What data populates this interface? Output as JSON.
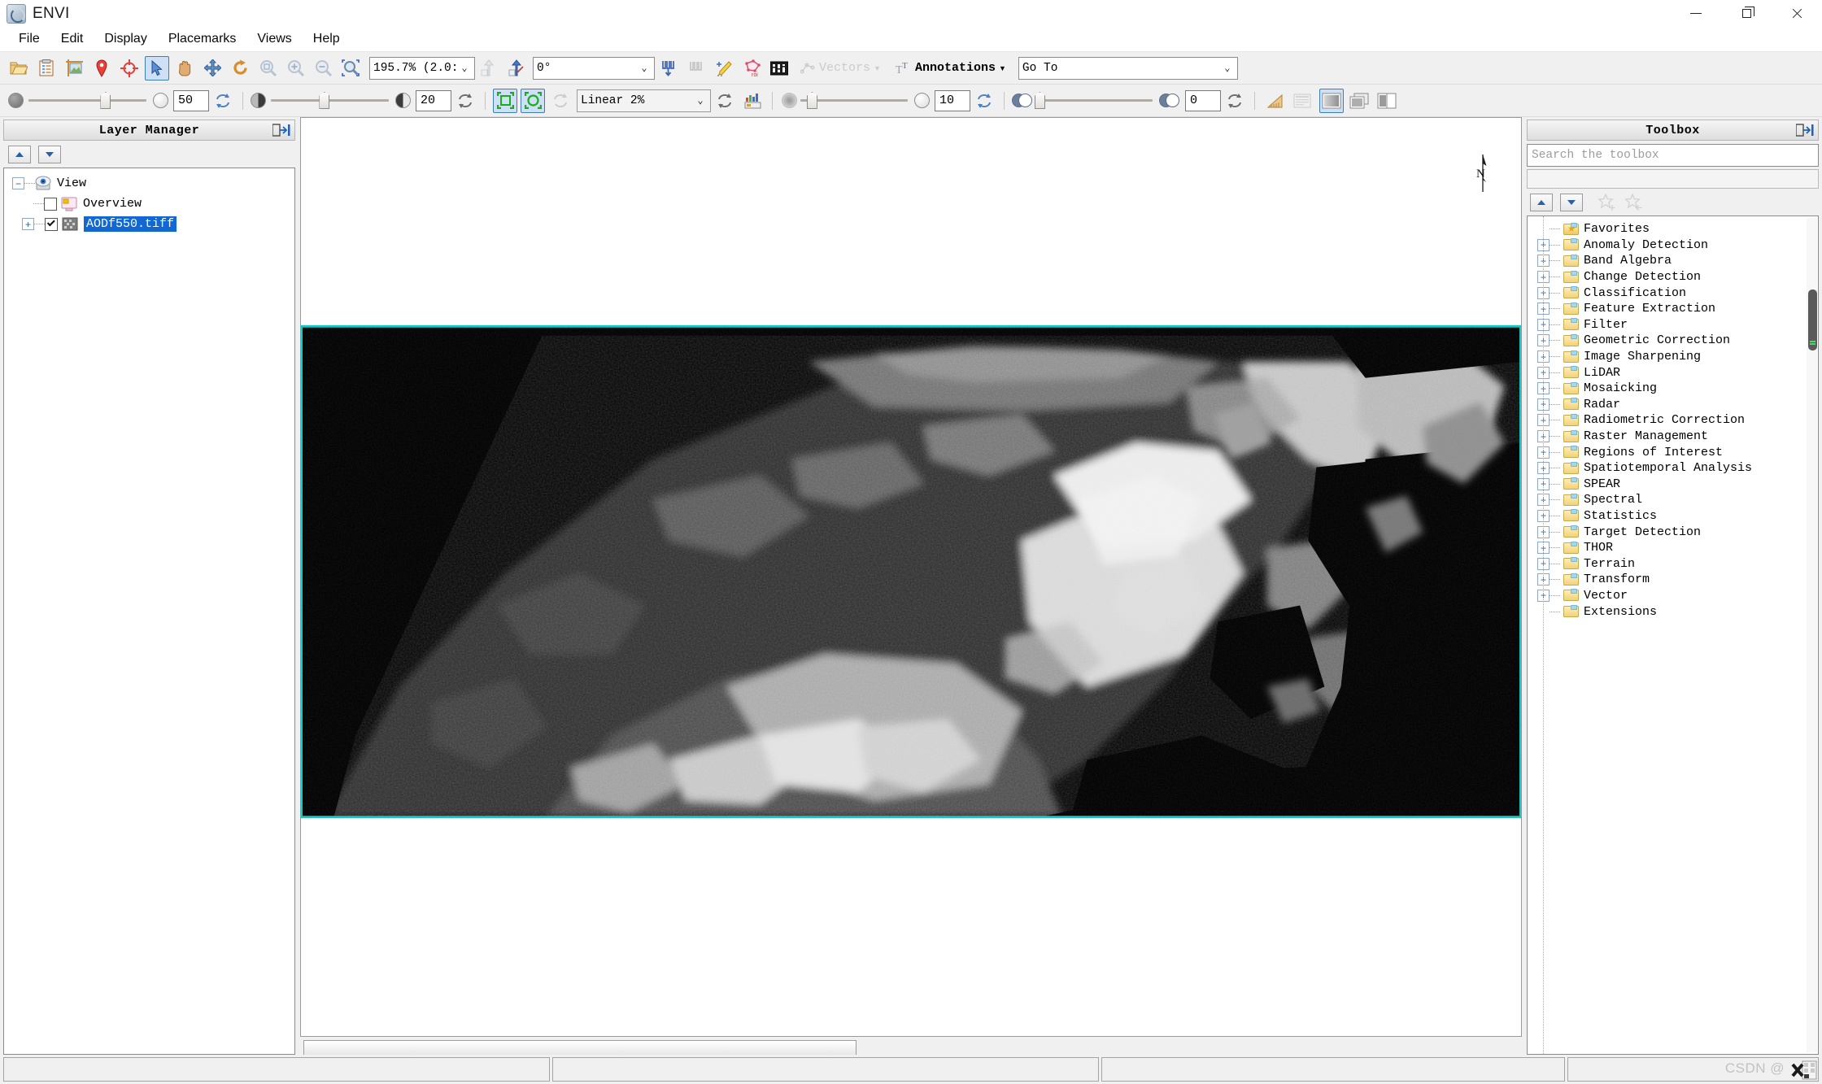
{
  "window": {
    "title": "ENVI",
    "controls": {
      "minimize": "minimize-icon",
      "maximize": "restore-icon",
      "close": "close-icon"
    }
  },
  "menubar": {
    "items": [
      {
        "label": "File"
      },
      {
        "label": "Edit"
      },
      {
        "label": "Display"
      },
      {
        "label": "Placemarks"
      },
      {
        "label": "Views"
      },
      {
        "label": "Help"
      }
    ]
  },
  "toolbar_main": {
    "buttons": [
      {
        "name": "open-file-icon",
        "tip": "Open"
      },
      {
        "name": "open-recent-icon",
        "tip": "Open Recent"
      },
      {
        "name": "crop-raster-icon",
        "tip": "Crop Raster"
      },
      {
        "name": "placemark-icon",
        "tip": "Placemark"
      },
      {
        "name": "crosshair-icon",
        "tip": "Crosshair"
      },
      {
        "name": "select-pointer-icon",
        "tip": "Select",
        "selected": true
      },
      {
        "name": "pan-hand-icon",
        "tip": "Pan"
      },
      {
        "name": "fly-icon",
        "tip": "Fly"
      },
      {
        "name": "rotate-icon",
        "tip": "Rotate"
      },
      {
        "name": "zoom-to-extent-icon",
        "tip": "Zoom to Full Extent",
        "disabled": true
      },
      {
        "name": "zoom-in-icon",
        "tip": "Zoom In",
        "disabled": true
      },
      {
        "name": "zoom-out-icon",
        "tip": "Zoom Out",
        "disabled": true
      },
      {
        "name": "zoom-to-selection-icon",
        "tip": "Zoom To Selection"
      }
    ],
    "zoom_value": "195.7% (2.0::",
    "rotation_value": "0°",
    "post_buttons": [
      {
        "name": "north-up-icon",
        "disabled": true
      },
      {
        "name": "rotate-north-icon",
        "disabled": false
      },
      {
        "name": "spectral-profile-icon"
      },
      {
        "name": "spectral-profile-alt-icon",
        "disabled": true
      },
      {
        "name": "annotation-pen-icon"
      },
      {
        "name": "region-of-interest-icon"
      },
      {
        "name": "band-math-icon"
      }
    ],
    "vectors_label": "Vectors",
    "annotations_label": "Annotations",
    "goto_value": "Go To"
  },
  "toolbar_display": {
    "transparency_value": "50",
    "brightness_value": "20",
    "stretch_value": "Linear 2%",
    "sharpen_value": "10",
    "blend_value": "0",
    "buttons": [
      {
        "name": "transparency-reset-icon"
      },
      {
        "name": "brightness-reset-icon"
      },
      {
        "name": "contrast-zoom-fit-icon",
        "selected": true
      },
      {
        "name": "contrast-zoom-region-icon",
        "selected": true
      },
      {
        "name": "stretch-refresh-icon",
        "disabled": true
      },
      {
        "name": "stretch-reset-icon"
      },
      {
        "name": "histogram-stretch-icon"
      },
      {
        "name": "sharpen-reset-icon"
      },
      {
        "name": "blend-reset-icon"
      },
      {
        "name": "measure-tool-icon"
      },
      {
        "name": "screen-capture-icon",
        "disabled": true
      },
      {
        "name": "view-single-icon",
        "selected": true
      },
      {
        "name": "view-stacked-icon"
      },
      {
        "name": "view-split-icon"
      }
    ]
  },
  "layer_manager": {
    "title": "Layer Manager",
    "pin_icon": "pin-panel-icon",
    "move_up_label": "move-layer-up",
    "move_down_label": "move-layer-down",
    "tree": [
      {
        "label": "View",
        "indent": 0,
        "expander": "-",
        "icon": "view-eye-icon",
        "checkbox": null
      },
      {
        "label": "Overview",
        "indent": 1,
        "expander": "",
        "icon": "overview-icon",
        "checkbox": false
      },
      {
        "label": "AODf550.tiff",
        "indent": 1,
        "expander": "+",
        "icon": "raster-layer-icon",
        "checkbox": true,
        "selected": true
      }
    ]
  },
  "toolbox": {
    "title": "Toolbox",
    "pin_icon": "pin-panel-icon",
    "search_placeholder": "Search the toolbox",
    "buttons": [
      {
        "name": "toolbox-collapse-up"
      },
      {
        "name": "toolbox-collapse-down"
      },
      {
        "name": "add-favorite-star-icon",
        "disabled": true
      },
      {
        "name": "remove-favorite-star-icon",
        "disabled": true
      }
    ],
    "items": [
      {
        "label": "Favorites",
        "expandable": false,
        "favorite": true
      },
      {
        "label": "Anomaly Detection",
        "expandable": true
      },
      {
        "label": "Band Algebra",
        "expandable": true
      },
      {
        "label": "Change Detection",
        "expandable": true
      },
      {
        "label": "Classification",
        "expandable": true
      },
      {
        "label": "Feature Extraction",
        "expandable": true
      },
      {
        "label": "Filter",
        "expandable": true
      },
      {
        "label": "Geometric Correction",
        "expandable": true
      },
      {
        "label": "Image Sharpening",
        "expandable": true
      },
      {
        "label": "LiDAR",
        "expandable": true
      },
      {
        "label": "Mosaicking",
        "expandable": true
      },
      {
        "label": "Radar",
        "expandable": true
      },
      {
        "label": "Radiometric Correction",
        "expandable": true
      },
      {
        "label": "Raster Management",
        "expandable": true
      },
      {
        "label": "Regions of Interest",
        "expandable": true
      },
      {
        "label": "Spatiotemporal Analysis",
        "expandable": true
      },
      {
        "label": "SPEAR",
        "expandable": true
      },
      {
        "label": "Spectral",
        "expandable": true
      },
      {
        "label": "Statistics",
        "expandable": true
      },
      {
        "label": "Target Detection",
        "expandable": true
      },
      {
        "label": "THOR",
        "expandable": true
      },
      {
        "label": "Terrain",
        "expandable": true
      },
      {
        "label": "Transform",
        "expandable": true
      },
      {
        "label": "Vector",
        "expandable": true
      },
      {
        "label": "Extensions",
        "expandable": false
      }
    ]
  },
  "view": {
    "north_arrow_label": "N",
    "raster_border_color": "#14c8c8",
    "raster_background": "#000000",
    "canvas_background": "#ffffff"
  },
  "statusbar": {
    "watermark": "CSDN @",
    "fields": [
      "",
      "",
      "",
      ""
    ]
  }
}
